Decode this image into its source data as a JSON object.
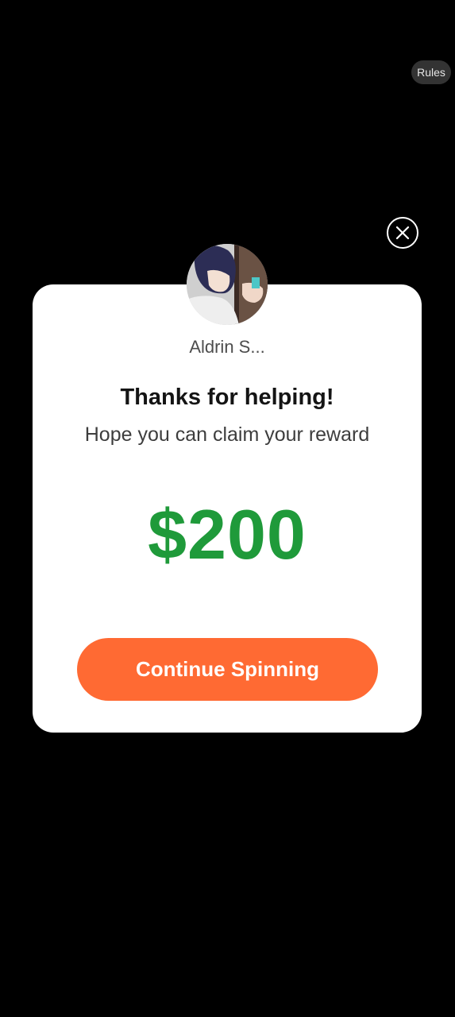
{
  "header": {
    "rules_label": "Rules"
  },
  "dialog": {
    "close_icon": "close-icon",
    "avatar_icon": "avatar",
    "username": "Aldrin S...",
    "title": "Thanks for helping!",
    "subtitle": "Hope you can claim your reward",
    "amount": "$200",
    "cta_label": "Continue Spinning"
  },
  "colors": {
    "background": "#000000",
    "card": "#ffffff",
    "amount_green": "#1f9a3a",
    "cta_orange": "#ff6a33",
    "rules_chip": "#333333"
  }
}
